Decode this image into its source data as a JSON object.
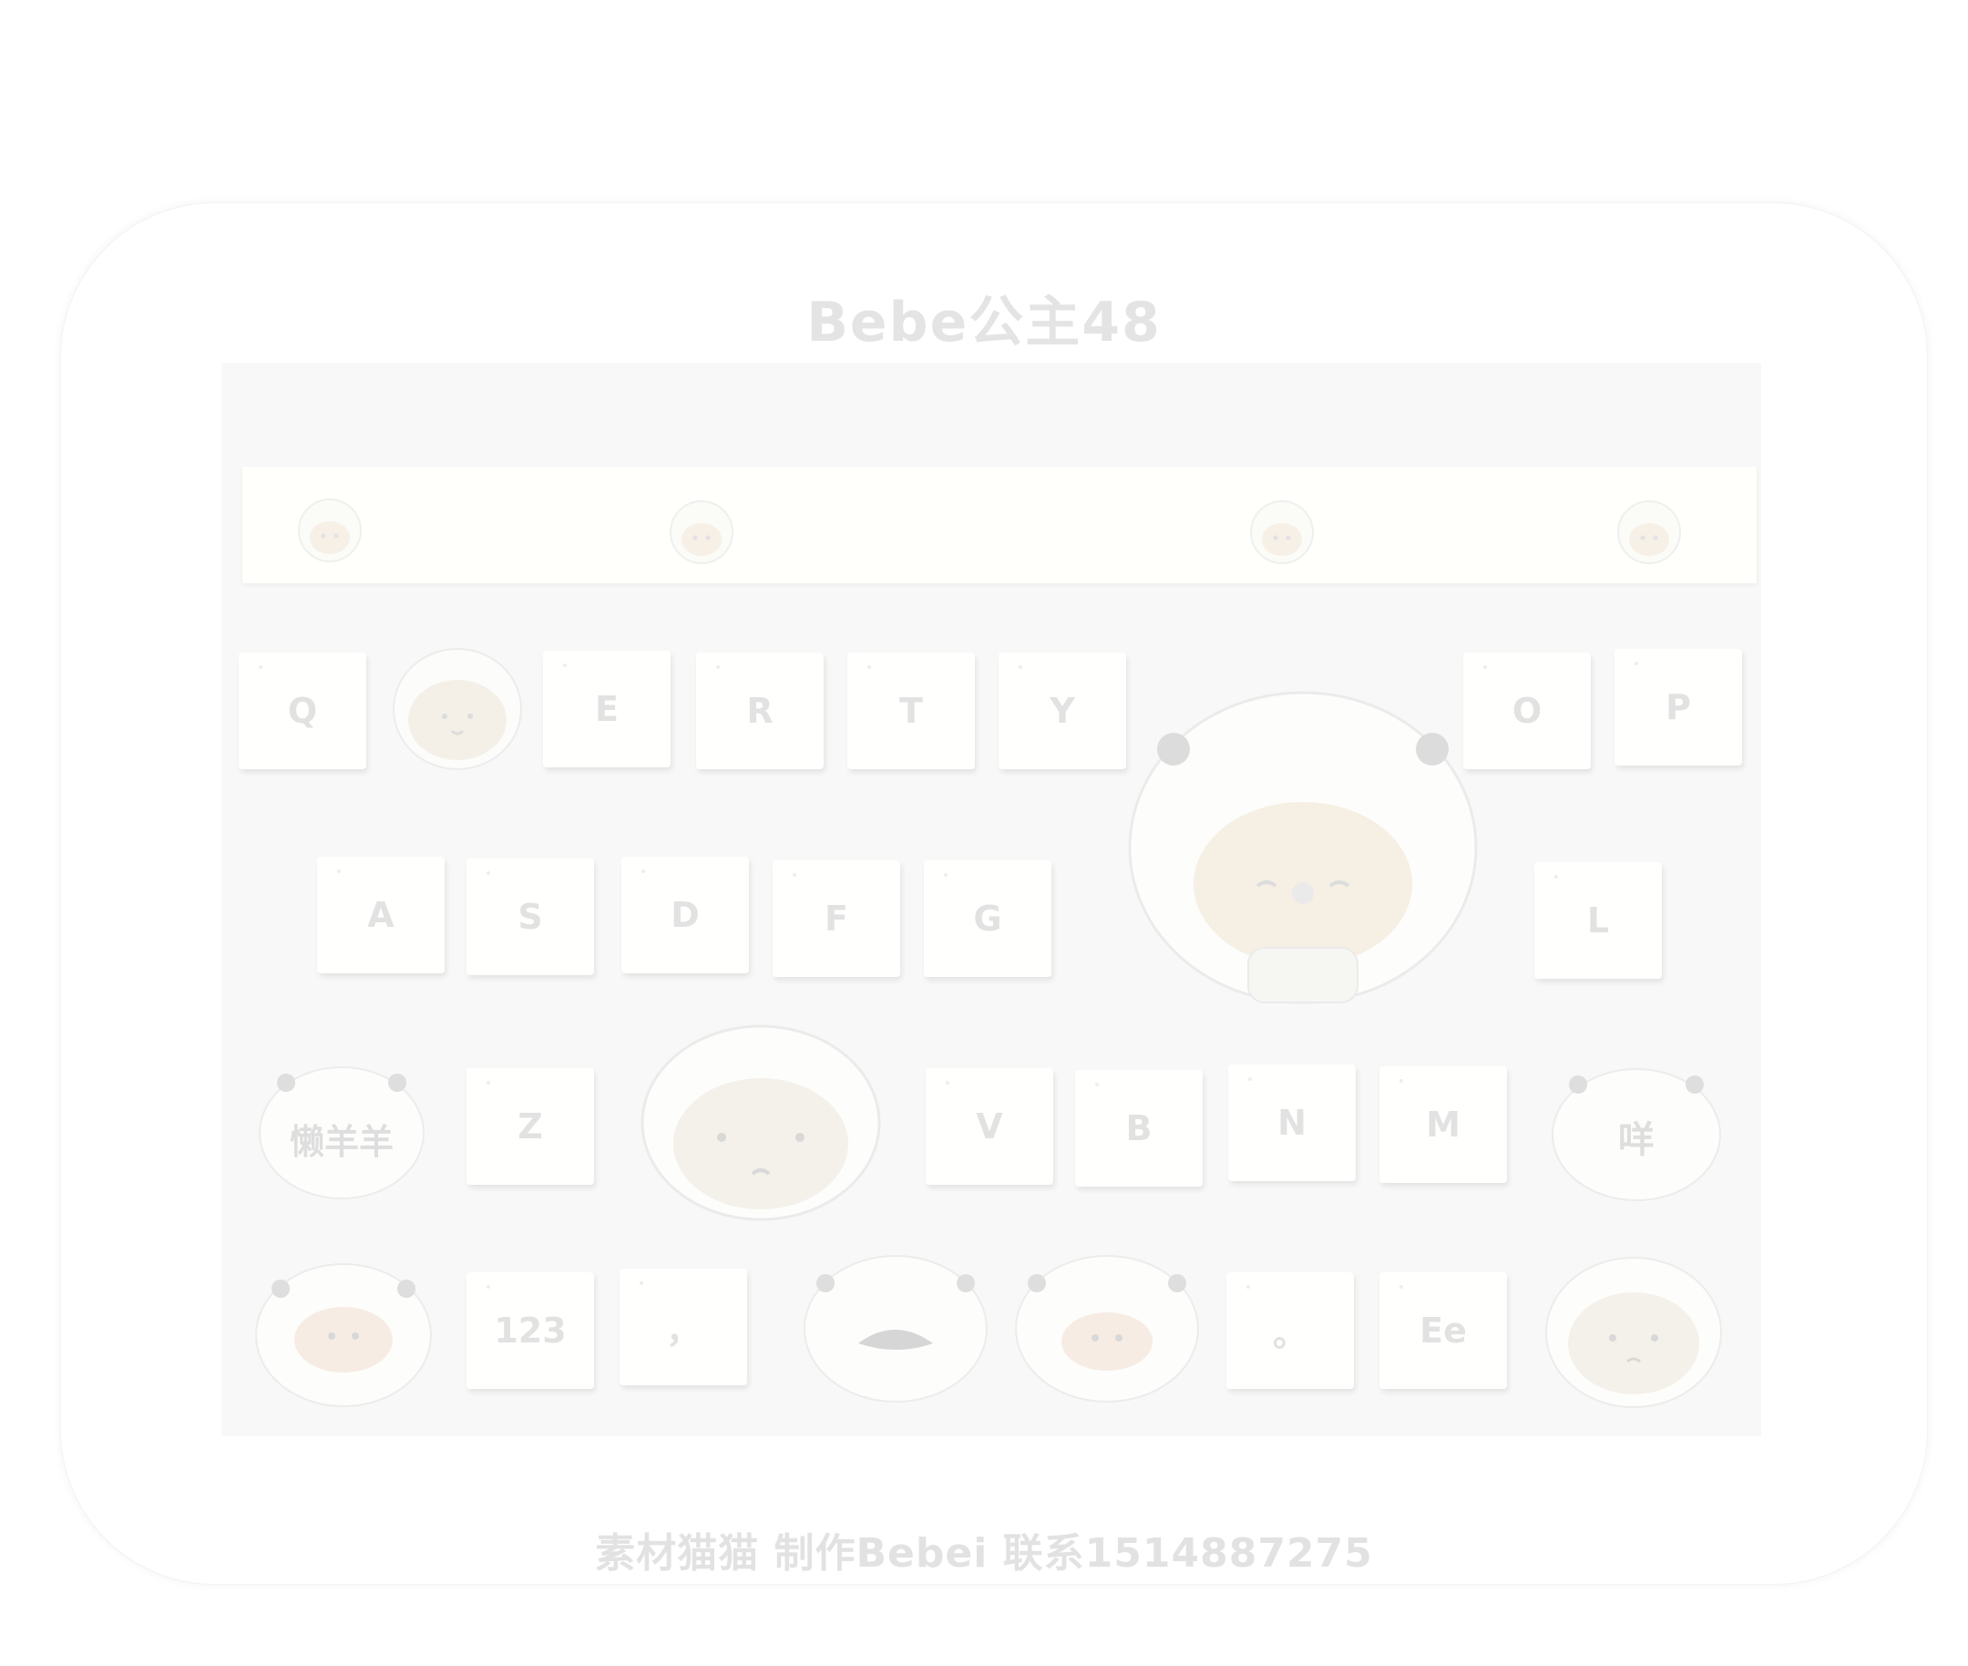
{
  "title": "Bebe公主48",
  "footer": "素材猫猫 制作Bebei  联系1514887275",
  "toolbar": {
    "items": [
      "sheep-face",
      "sheep-face",
      "sheep-face",
      "sheep-face"
    ]
  },
  "keys": {
    "row1": [
      "Q",
      "E",
      "R",
      "T",
      "Y",
      "O",
      "P"
    ],
    "row2": [
      "A",
      "S",
      "D",
      "F",
      "G",
      "L"
    ],
    "row3": [
      "Z",
      "V",
      "B",
      "N",
      "M"
    ],
    "row4": {
      "numbers": "123",
      "comma": "，",
      "period": "。",
      "case": "Ee"
    }
  },
  "sheep_keys": {
    "shift": "懒羊羊",
    "sound": "咩"
  },
  "colors": {
    "background": "#ffffff",
    "board": "#f8f8f8",
    "key": "#fffffd",
    "text": "#e2e2e2",
    "sheep_face": "#f5efe6"
  }
}
